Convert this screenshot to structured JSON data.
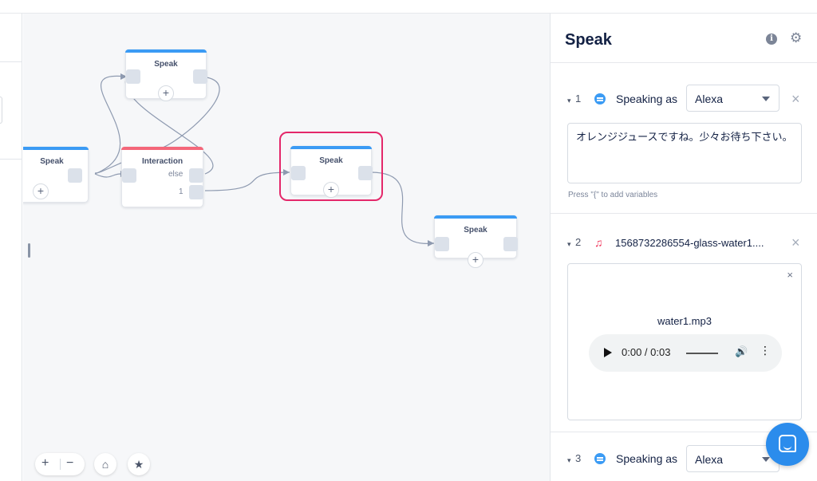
{
  "canvas": {
    "nodes": [
      {
        "title": "Speak"
      },
      {
        "title": "Speak"
      },
      {
        "title": "Interaction",
        "ports": [
          "else",
          "1"
        ]
      },
      {
        "title": "Speak"
      },
      {
        "title": "Speak"
      }
    ],
    "add_symbol": "+",
    "controls": {
      "zoom_in": "+",
      "zoom_out": "−",
      "home": "⌂",
      "favorite": "★"
    }
  },
  "panel": {
    "title": "Speak",
    "info_glyph": "i",
    "settings_glyph": "⚙",
    "steps": [
      {
        "number": "1",
        "label": "Speaking as",
        "voice": "Alexa",
        "text": "オレンジジュースですね。少々お待ち下さい。",
        "hint": "Press \"{\" to add variables"
      },
      {
        "number": "2",
        "filename": "1568732286554-glass-water1....",
        "audio_name": "water1.mp3",
        "time": "0:00 / 0:03"
      },
      {
        "number": "3",
        "label": "Speaking as",
        "voice": "Alexa"
      }
    ],
    "caret": "▾",
    "close": "×"
  },
  "icons": {
    "speech": "speech-bubble-icon",
    "music": "music-note-icon",
    "chat": "chat-launcher-icon"
  },
  "colors": {
    "speak_bar": "#3b9bf4",
    "interaction_bar": "#f4677a",
    "selection": "#e4286a",
    "accent": "#2b8cec"
  }
}
